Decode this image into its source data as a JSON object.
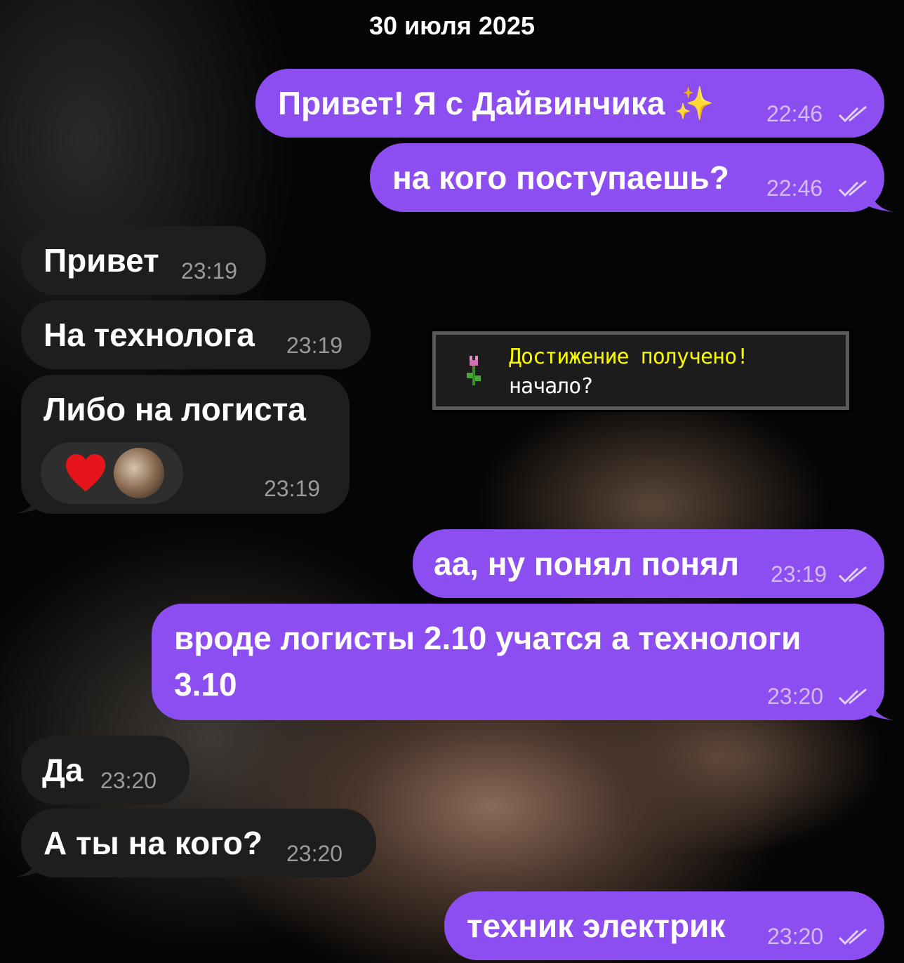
{
  "date_header": "30 июля 2025",
  "messages": [
    {
      "direction": "outgoing",
      "text": "Привет! Я с Дайвинчика ✨",
      "time": "22:46",
      "status": "read"
    },
    {
      "direction": "outgoing",
      "text": "на кого поступаешь?",
      "time": "22:46",
      "status": "read"
    },
    {
      "direction": "incoming",
      "text": "Привет",
      "time": "23:19"
    },
    {
      "direction": "incoming",
      "text": "На технолога",
      "time": "23:19"
    },
    {
      "direction": "incoming",
      "text": "Либо на логиста",
      "time": "23:19",
      "reactions": [
        {
          "emoji": "heart-red"
        }
      ]
    },
    {
      "direction": "outgoing",
      "text": "аа, ну понял понял",
      "time": "23:19",
      "status": "read"
    },
    {
      "direction": "outgoing",
      "text_line1": "вроде логисты 2.10 учатся а технологи",
      "text_line2": "3.10",
      "time": "23:20",
      "status": "read"
    },
    {
      "direction": "incoming",
      "text": "Да",
      "time": "23:20"
    },
    {
      "direction": "incoming",
      "text": "А ты на кого?",
      "time": "23:20"
    },
    {
      "direction": "outgoing",
      "text": "техник электрик",
      "time": "23:20",
      "status": "read"
    }
  ],
  "sticker": {
    "title": "Достижение получено!",
    "subtitle": "начало?",
    "icon": "tulip-icon"
  },
  "colors": {
    "outgoing_bubble": "#8c4ef0",
    "incoming_bubble": "#1e1e1e",
    "achievement_title": "#f8f800"
  }
}
